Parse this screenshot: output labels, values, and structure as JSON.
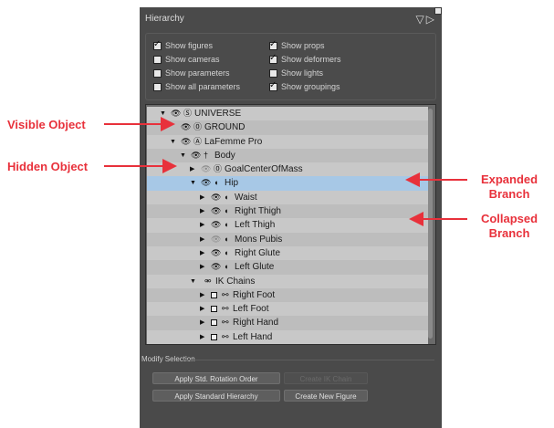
{
  "panel": {
    "title": "Hierarchy",
    "title_icons": "▽▷"
  },
  "options": [
    {
      "label": "Show figures",
      "checked": true
    },
    {
      "label": "Show props",
      "checked": true
    },
    {
      "label": "Show cameras",
      "checked": false
    },
    {
      "label": "Show deformers",
      "checked": true
    },
    {
      "label": "Show parameters",
      "checked": false
    },
    {
      "label": "Show lights",
      "checked": false
    },
    {
      "label": "Show all parameters",
      "checked": false
    },
    {
      "label": "Show groupings",
      "checked": true
    }
  ],
  "tree": [
    {
      "label": "UNIVERSE",
      "expander": "▼",
      "eye": "👁",
      "icon": "universe-icon",
      "glyph": "Ⓢ"
    },
    {
      "label": "GROUND",
      "expander": "",
      "eye": "👁",
      "icon": "prop-icon",
      "glyph": "⓪"
    },
    {
      "label": "LaFemme Pro",
      "expander": "▼",
      "eye": "👁",
      "icon": "figure-icon",
      "glyph": "Ⓐ"
    },
    {
      "label": "Body",
      "expander": "▼",
      "eye": "👁",
      "icon": "body-icon",
      "glyph": "†"
    },
    {
      "label": "GoalCenterOfMass",
      "expander": "▶",
      "eye": "👁",
      "icon": "prop-icon",
      "glyph": "⓪",
      "hidden": true
    },
    {
      "label": "Hip",
      "expander": "▼",
      "eye": "👁",
      "icon": "bone-icon",
      "glyph": "◖",
      "selected": true
    },
    {
      "label": "Waist",
      "expander": "▶",
      "eye": "👁",
      "icon": "bone-icon",
      "glyph": "◖"
    },
    {
      "label": "Right Thigh",
      "expander": "▶",
      "eye": "👁",
      "icon": "bone-icon",
      "glyph": "◖"
    },
    {
      "label": "Left Thigh",
      "expander": "▶",
      "eye": "👁",
      "icon": "bone-icon",
      "glyph": "◖"
    },
    {
      "label": "Mons Pubis",
      "expander": "▶",
      "eye": "👁",
      "icon": "bone-icon",
      "glyph": "◖",
      "hidden": true
    },
    {
      "label": "Right Glute",
      "expander": "▶",
      "eye": "👁",
      "icon": "bone-icon",
      "glyph": "◖"
    },
    {
      "label": "Left Glute",
      "expander": "▶",
      "eye": "👁",
      "icon": "bone-icon",
      "glyph": "◖"
    },
    {
      "label": "IK Chains",
      "expander": "▼",
      "eye": "",
      "icon": "ik-chains-icon",
      "glyph": "⚮"
    },
    {
      "label": "Right Foot",
      "expander": "▶",
      "checkbox": true,
      "icon": "ik-chain-icon",
      "glyph": "⚯"
    },
    {
      "label": "Left Foot",
      "expander": "▶",
      "checkbox": true,
      "icon": "ik-chain-icon",
      "glyph": "⚯"
    },
    {
      "label": "Right Hand",
      "expander": "▶",
      "checkbox": true,
      "icon": "ik-chain-icon",
      "glyph": "⚯"
    },
    {
      "label": "Left Hand",
      "expander": "▶",
      "checkbox": true,
      "icon": "ik-chain-icon",
      "glyph": "⚯"
    }
  ],
  "modify": {
    "title": "Modify Selection",
    "buttons": [
      {
        "label": "Apply Std. Rotation Order",
        "enabled": true
      },
      {
        "label": "Create IK Chain",
        "enabled": false
      },
      {
        "label": "Apply Standard Hierarchy",
        "enabled": true
      },
      {
        "label": "Create New Figure",
        "enabled": true
      }
    ]
  },
  "callouts": {
    "visible_object": "Visible Object",
    "hidden_object": "Hidden Object",
    "expanded_branch_line1": "Expanded",
    "expanded_branch_line2": "Branch",
    "collapsed_branch_line1": "Collapsed",
    "collapsed_branch_line2": "Branch"
  },
  "colors": {
    "callout": "#e8313b",
    "selected_row": "#a7c8e6"
  }
}
